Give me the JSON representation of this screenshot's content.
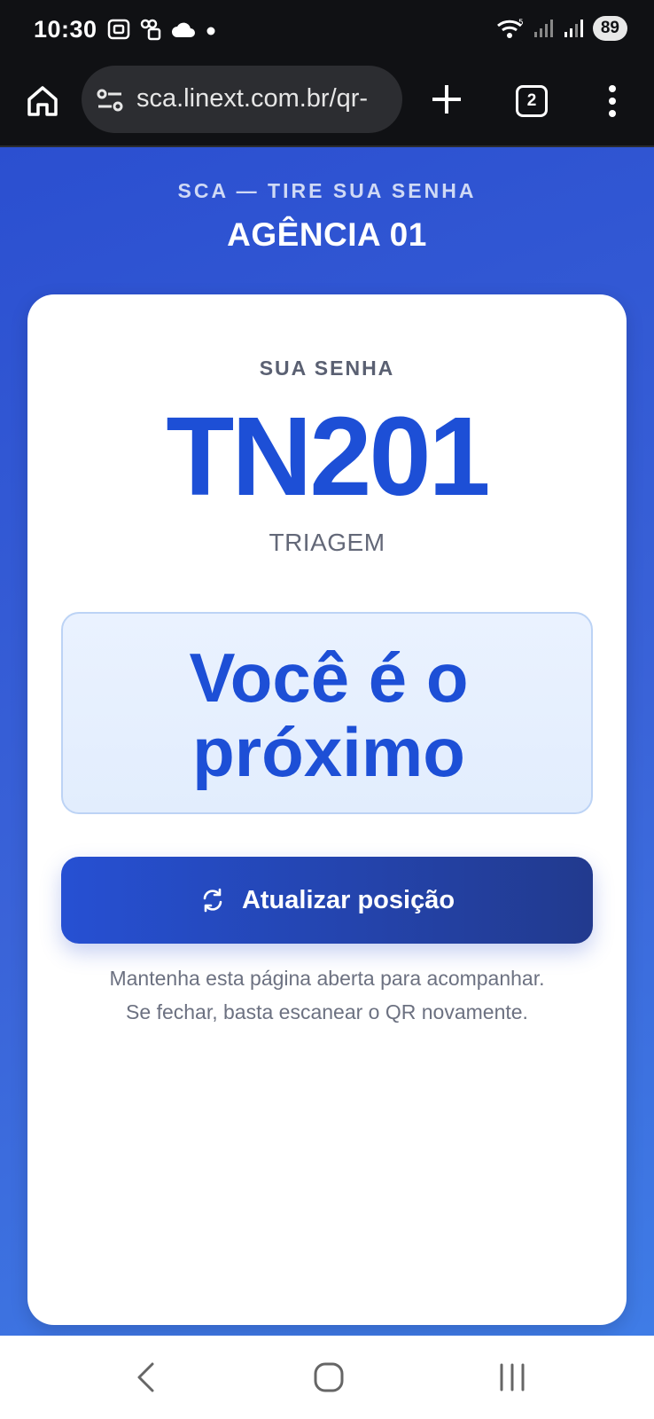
{
  "status_bar": {
    "time": "10:30",
    "battery": "89",
    "left_icons": [
      "screenshot-icon",
      "sim-icon",
      "cloud-icon",
      "dot-icon"
    ],
    "right_icons": [
      "wifi-icon",
      "signal-icon",
      "signal-icon"
    ]
  },
  "browser": {
    "url": "sca.linext.com.br/qr-",
    "tab_count": "2",
    "icons": [
      "home-icon",
      "site-settings-icon",
      "plus-icon",
      "tabs-icon",
      "menu-icon"
    ]
  },
  "page": {
    "brand_line": "SCA — TIRE SUA SENHA",
    "agency": "AGÊNCIA 01",
    "ticket_label": "SUA SENHA",
    "ticket_number": "TN201",
    "service": "TRIAGEM",
    "status_line1": "Você é o",
    "status_line2": "próximo",
    "refresh_label": "Atualizar posição",
    "help_line1": "Mantenha esta página aberta para acompanhar.",
    "help_line2": "Se fechar, basta escanear o QR novamente."
  },
  "colors": {
    "primary": "#1d4fd6",
    "background_gradient": [
      "#2b4fd0",
      "#3f7ce6"
    ],
    "status_box": "#e6efff"
  }
}
